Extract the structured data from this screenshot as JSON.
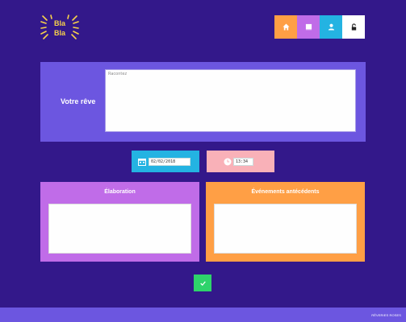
{
  "logo": {
    "line1": "Bla",
    "line2": "Bla",
    "color": "#f7d24a"
  },
  "nav": {
    "items": [
      {
        "icon": "home-icon",
        "color": "#ff9f45"
      },
      {
        "icon": "book-icon",
        "color": "#c06ce8"
      },
      {
        "icon": "user-icon",
        "color": "#24b3e2"
      },
      {
        "icon": "lock-icon",
        "color": "#ffffff"
      }
    ]
  },
  "dream": {
    "label": "Votre rêve",
    "placeholder": "Racontez"
  },
  "date": {
    "value": "02/02/2018"
  },
  "time": {
    "value": "13:34"
  },
  "elaboration": {
    "title": "Élaboration"
  },
  "events": {
    "title": "Événements antécédents"
  },
  "footer": {
    "text": "RÊVERIES ROSES"
  },
  "colors": {
    "background": "#33188a",
    "panel": "#6c56e0",
    "submit": "#2ed36b"
  }
}
